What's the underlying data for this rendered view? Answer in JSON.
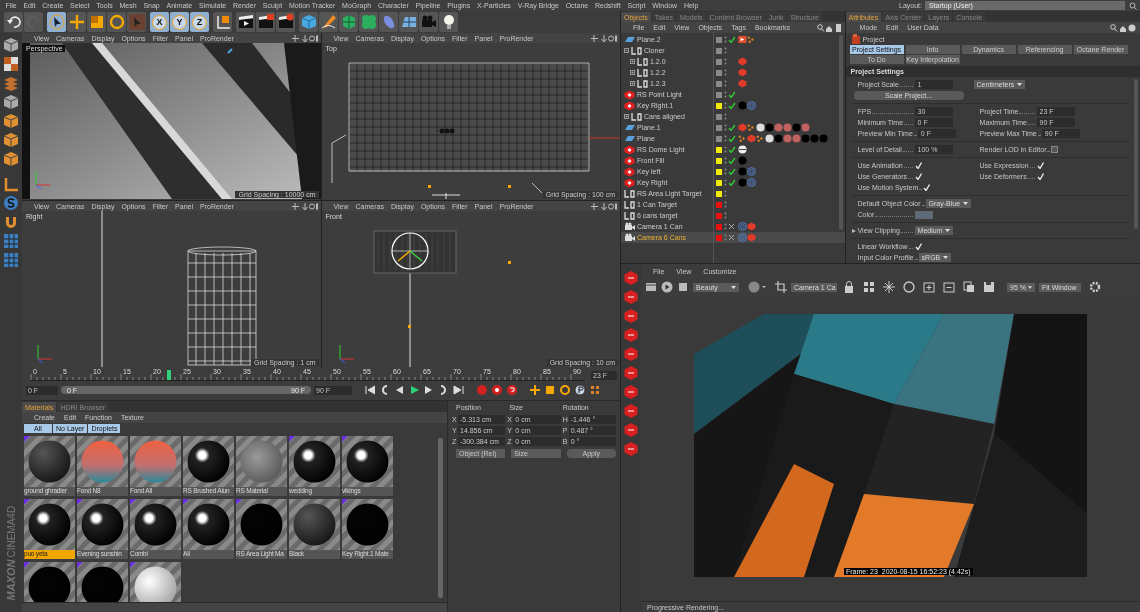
{
  "menu_bar": {
    "items": [
      "File",
      "Edit",
      "Create",
      "Select",
      "Tools",
      "Mesh",
      "Snap",
      "Animate",
      "Simulate",
      "Render",
      "Sculpt",
      "Motion Tracker",
      "MoGraph",
      "Character",
      "Pipeline",
      "Plugins",
      "X-Particles",
      "V-Ray Bridge",
      "Octane",
      "Redshift",
      "Script",
      "Window",
      "Help"
    ],
    "layout_label": "Layout:",
    "layout_value": "Startup (User)"
  },
  "toolbar": [
    {
      "kind": "undo",
      "selected": false
    },
    {
      "kind": "redo",
      "selected": false
    },
    {
      "kind": "select",
      "selected": true
    },
    {
      "kind": "move",
      "selected": false
    },
    {
      "kind": "scale",
      "selected": false
    },
    {
      "kind": "rotate",
      "selected": false
    },
    {
      "kind": "recent",
      "selected": false
    },
    {
      "kind": "axis",
      "label": "X",
      "selected": true
    },
    {
      "kind": "axis",
      "label": "Y",
      "selected": true
    },
    {
      "kind": "axis",
      "label": "Z",
      "selected": true
    },
    {
      "kind": "coord",
      "selected": false
    },
    {
      "kind": "render-view",
      "selected": false
    },
    {
      "kind": "render",
      "selected": false
    },
    {
      "kind": "render-settings",
      "selected": false
    },
    {
      "kind": "cube",
      "selected": false
    },
    {
      "kind": "pen",
      "selected": false
    },
    {
      "kind": "subdivision",
      "selected": false
    },
    {
      "kind": "cloner",
      "selected": false
    },
    {
      "kind": "deformer",
      "selected": false
    },
    {
      "kind": "floor",
      "selected": false
    },
    {
      "kind": "camera",
      "selected": false
    },
    {
      "kind": "light",
      "selected": false
    }
  ],
  "viewports": [
    {
      "kind": "perspective",
      "label": "Perspective",
      "menu": [
        "View",
        "Cameras",
        "Display",
        "Options",
        "Filter",
        "Panel",
        "ProRender"
      ],
      "grid_spacing": "Grid Spacing : 10000 cm"
    },
    {
      "kind": "top",
      "label": "Top",
      "menu": [
        "View",
        "Cameras",
        "Display",
        "Options",
        "Filter",
        "Panel",
        "ProRender"
      ],
      "grid_spacing": "Grid Spacing : 100 cm"
    },
    {
      "kind": "right",
      "label": "Right",
      "menu": [
        "View",
        "Cameras",
        "Display",
        "Options",
        "Filter",
        "Panel",
        "ProRender"
      ],
      "grid_spacing": "Grid Spacing : 1 cm"
    },
    {
      "kind": "front",
      "label": "Front",
      "menu": [
        "View",
        "Cameras",
        "Display",
        "Options",
        "Filter",
        "Panel",
        "ProRender"
      ],
      "grid_spacing": "Grid Spacing : 10 cm"
    }
  ],
  "timeline": {
    "ticks": [
      "0",
      "5",
      "10",
      "15",
      "20",
      "25",
      "30",
      "35",
      "40",
      "45",
      "50",
      "55",
      "60",
      "65",
      "70",
      "75",
      "80",
      "85",
      "90"
    ],
    "level": 0.2556,
    "current": "23 F",
    "start": "0 F",
    "range_start": "0 F",
    "range_end": "90 F",
    "end": "90 F"
  },
  "materials": {
    "tabs": [
      {
        "label": "Materials",
        "selected": true
      },
      {
        "label": "HDRI Browser",
        "selected": false
      }
    ],
    "menu": [
      "Create",
      "Edit",
      "Function",
      "Texture"
    ],
    "filters": [
      {
        "label": "All",
        "selected": true
      },
      {
        "label": "No Layer",
        "selected": true
      },
      {
        "label": "Droplets",
        "selected": true
      }
    ],
    "items": [
      {
        "name": "ground ghradier",
        "kind": "dark",
        "marker": true,
        "selected": false
      },
      {
        "name": "Fond N8",
        "kind": "gradient",
        "marker": false,
        "selected": false
      },
      {
        "name": "Fond All",
        "kind": "gradient",
        "marker": false,
        "selected": false
      },
      {
        "name": "RS Brushed Alun",
        "kind": "glossy",
        "marker": false,
        "selected": false
      },
      {
        "name": "RS Material",
        "kind": "gray",
        "marker": false,
        "selected": false
      },
      {
        "name": "wedding",
        "kind": "glossy",
        "marker": true,
        "selected": false
      },
      {
        "name": "vikings",
        "kind": "glossy",
        "marker": true,
        "selected": false
      },
      {
        "name": "puo yeta",
        "kind": "glossy",
        "marker": true,
        "selected": true
      },
      {
        "name": "Evening sunshin",
        "kind": "glossy",
        "marker": true,
        "selected": false
      },
      {
        "name": "Combi",
        "kind": "glossy",
        "marker": true,
        "selected": false
      },
      {
        "name": "All",
        "kind": "glossy",
        "marker": true,
        "selected": false
      },
      {
        "name": "RS Area Light Ma",
        "kind": "black",
        "marker": true,
        "selected": false
      },
      {
        "name": "Black",
        "kind": "dark",
        "marker": false,
        "selected": false
      },
      {
        "name": "Key Right.1 Mate",
        "kind": "black",
        "marker": true,
        "selected": false
      },
      {
        "kind": "black",
        "marker": true,
        "selected": false
      },
      {
        "kind": "black",
        "marker": true,
        "selected": false
      },
      {
        "kind": "white",
        "marker": true,
        "selected": false
      }
    ]
  },
  "coordinates": {
    "headers": [
      "Position",
      "Size",
      "Rotation"
    ],
    "rows": [
      {
        "axis": "X",
        "position": "-5.313 cm",
        "size_axis": "X",
        "size": "0 cm",
        "rotation_axis": "H",
        "rotation": "-1.446 °"
      },
      {
        "axis": "Y",
        "position": "14.856 cm",
        "size_axis": "Y",
        "size": "0 cm",
        "rotation_axis": "P",
        "rotation": "0.487 °"
      },
      {
        "axis": "Z",
        "position": "-300.384 cm",
        "size_axis": "Z",
        "size": "0 cm",
        "rotation_axis": "B",
        "rotation": "0 °"
      }
    ],
    "mode": "Object (Rel)",
    "size_mode": "Size",
    "apply": "Apply"
  },
  "objects_panel": {
    "tabs": [
      {
        "label": "Objects",
        "selected": true
      },
      {
        "label": "Takes",
        "selected": false
      },
      {
        "label": "Models",
        "selected": false
      },
      {
        "label": "Content Browser",
        "selected": false
      },
      {
        "label": "Junk",
        "selected": false
      },
      {
        "label": "Structure",
        "selected": false
      }
    ],
    "menu": [
      "File",
      "Edit",
      "View",
      "Objects",
      "Tags",
      "Bookmarks"
    ],
    "objects": [
      {
        "name": "Plane.2",
        "kind": "plane",
        "color": "#8a8a8a",
        "enabled": true,
        "selected": false,
        "tags": [
          {
            "kind": "render"
          },
          {
            "kind": "dots"
          }
        ]
      },
      {
        "name": "Cloner",
        "kind": "null",
        "color": "#8a8a8a",
        "selected": false,
        "expanded": true,
        "children": [
          {
            "name": "1.2.0",
            "kind": "null",
            "color": "#8a8a8a",
            "selected": false,
            "expanded": false,
            "tags": [
              {
                "kind": "hexagon"
              }
            ]
          },
          {
            "name": "1.2.2",
            "kind": "null",
            "color": "#8a8a8a",
            "selected": false,
            "expanded": false,
            "tags": [
              {
                "kind": "hexagon"
              }
            ]
          },
          {
            "name": "1.2.3",
            "kind": "null",
            "color": "#8a8a8a",
            "selected": false,
            "expanded": false,
            "tags": [
              {
                "kind": "hexagon"
              }
            ]
          }
        ]
      },
      {
        "name": "RS Point Light",
        "kind": "light",
        "color": "#8a8a8a",
        "enabled": true,
        "selected": false
      },
      {
        "name": "Key Right.1",
        "kind": "light",
        "color": "#f2ea00",
        "enabled": true,
        "selected": false,
        "tags": [
          {
            "kind": "black"
          },
          {
            "kind": "target"
          }
        ]
      },
      {
        "name": "Cans aligned",
        "kind": "null",
        "color": "#8a8a8a",
        "selected": false,
        "expanded": false
      },
      {
        "name": "Plane.1",
        "kind": "plane",
        "color": "#8a8a8a",
        "enabled": true,
        "selected": false,
        "tags": [
          {
            "kind": "hexagon"
          },
          {
            "kind": "dots"
          },
          {
            "kind": "white"
          },
          {
            "kind": "black"
          },
          {
            "kind": "pink"
          },
          {
            "kind": "pink"
          },
          {
            "kind": "black"
          },
          {
            "kind": "pink"
          }
        ]
      },
      {
        "name": "Plane",
        "kind": "plane",
        "color": "#8a8a8a",
        "enabled": true,
        "selected": false,
        "tags": [
          {
            "kind": "dots"
          },
          {
            "kind": "hexagon"
          },
          {
            "kind": "dots"
          },
          {
            "kind": "white"
          },
          {
            "kind": "black"
          },
          {
            "kind": "pink"
          },
          {
            "kind": "pink"
          },
          {
            "kind": "black"
          },
          {
            "kind": "black"
          },
          {
            "kind": "black"
          }
        ]
      },
      {
        "name": "RS Dome Light",
        "kind": "light",
        "color": "#f2ea00",
        "enabled": true,
        "selected": false,
        "tags": [
          {
            "kind": "dome"
          }
        ]
      },
      {
        "name": "Front Fill",
        "kind": "light",
        "color": "#f2ea00",
        "enabled": true,
        "selected": false,
        "tags": [
          {
            "kind": "black"
          }
        ]
      },
      {
        "name": "Key left",
        "kind": "light",
        "color": "#f2ea00",
        "enabled": true,
        "selected": false,
        "tags": [
          {
            "kind": "black"
          },
          {
            "kind": "target"
          }
        ]
      },
      {
        "name": "Key Right",
        "kind": "light",
        "color": "#f2ea00",
        "enabled": true,
        "selected": false,
        "tags": [
          {
            "kind": "black"
          },
          {
            "kind": "target"
          }
        ]
      },
      {
        "name": "RS Area Light Target",
        "kind": "null",
        "color": "#f2ea00",
        "selected": false
      },
      {
        "name": "1 Can Target",
        "kind": "null",
        "color": "#e81010",
        "selected": false
      },
      {
        "name": "6 cans target",
        "kind": "null",
        "color": "#e81010",
        "selected": false
      },
      {
        "name": "Camera 1 Can",
        "kind": "camera",
        "color": "#e81010",
        "enabled": false,
        "selected": false,
        "tags": [
          {
            "kind": "target"
          },
          {
            "kind": "hexagon"
          }
        ]
      },
      {
        "name": "Camera 6 Cans",
        "kind": "camera",
        "color": "#e81010",
        "enabled": false,
        "selected": true,
        "tags": [
          {
            "kind": "target"
          },
          {
            "kind": "hexagon"
          }
        ]
      }
    ]
  },
  "attributes": {
    "tabs": [
      {
        "label": "Attributes",
        "selected": true
      },
      {
        "label": "Axis Center",
        "selected": false
      },
      {
        "label": "Layers",
        "selected": false
      },
      {
        "label": "Console",
        "selected": false
      }
    ],
    "menu": [
      "Mode",
      "Edit",
      "User Data"
    ],
    "object_name": "Project",
    "subtabs": [
      {
        "label": "Project Settings",
        "selected": true
      },
      {
        "label": "Info",
        "selected": false
      },
      {
        "label": "Dynamics",
        "selected": false
      },
      {
        "label": "Referencing",
        "selected": false
      },
      {
        "label": "Octane Render",
        "selected": false
      },
      {
        "label": "To Do",
        "selected": false
      },
      {
        "label": "Key Interpolation",
        "selected": false
      }
    ],
    "section_title": "Project Settings",
    "groups": [
      {
        "rows": [
          [
            {
              "kind": "number",
              "label": "Project Scale",
              "value": "1"
            },
            {
              "kind": "dropdown",
              "value": "Centimeters"
            }
          ],
          [
            {
              "kind": "button",
              "label": "Scale Project..."
            }
          ]
        ]
      },
      {
        "rows": [
          [
            {
              "kind": "number",
              "label": "FPS",
              "value": "30"
            },
            {
              "kind": "number",
              "label": "Project Time",
              "value": "23 F"
            }
          ],
          [
            {
              "kind": "number",
              "label": "Minimum Time",
              "value": "0 F"
            },
            {
              "kind": "number",
              "label": "Maximum Time",
              "value": "90 F"
            }
          ],
          [
            {
              "kind": "number",
              "label": "Preview Min Time",
              "value": "0 F"
            },
            {
              "kind": "number",
              "label": "Preview Max Time",
              "value": "90 F"
            }
          ]
        ]
      },
      {
        "rows": [
          [
            {
              "kind": "number",
              "label": "Level of Detail",
              "value": "100 %"
            },
            {
              "kind": "check",
              "label": "Render LOD in Editor",
              "checked": false
            }
          ]
        ]
      },
      {
        "rows": [
          [
            {
              "kind": "check",
              "label": "Use Animation",
              "checked": true
            },
            {
              "kind": "check",
              "label": "Use Expression",
              "checked": true
            }
          ],
          [
            {
              "kind": "check",
              "label": "Use Generators",
              "checked": true
            },
            {
              "kind": "check",
              "label": "Use Deformers",
              "checked": true
            }
          ],
          [
            {
              "kind": "check",
              "label": "Use Motion System",
              "checked": true
            }
          ]
        ]
      },
      {
        "rows": [
          [
            {
              "kind": "dropdown",
              "label": "Default Object Color",
              "value": "Gray-Blue"
            }
          ],
          [
            {
              "kind": "color",
              "label": "Color",
              "color": "#5d6b7c"
            }
          ]
        ]
      },
      {
        "expanded": false,
        "rows": [
          [
            {
              "kind": "dropdown",
              "label": "View Clipping",
              "value": "Medium"
            }
          ]
        ]
      },
      {
        "rows": [
          [
            {
              "kind": "check",
              "label": "Linear Workflow",
              "checked": true
            }
          ],
          [
            {
              "kind": "dropdown",
              "label": "Input Color Profile",
              "value": "sRGB"
            }
          ]
        ]
      }
    ]
  },
  "picture_viewer": {
    "menu": [
      "File",
      "View",
      "Customize"
    ],
    "pass": "Beauty",
    "camera": "Camera 1 Ca",
    "zoom": "95 %",
    "fit": "Fit Window",
    "overlay": "Frame: 23  2020-08-15 16:52:23 (4.42s)",
    "status": "Progressive Rendering..."
  },
  "logo": {
    "brand": "MAXON",
    "product": "CINEMA4D"
  }
}
